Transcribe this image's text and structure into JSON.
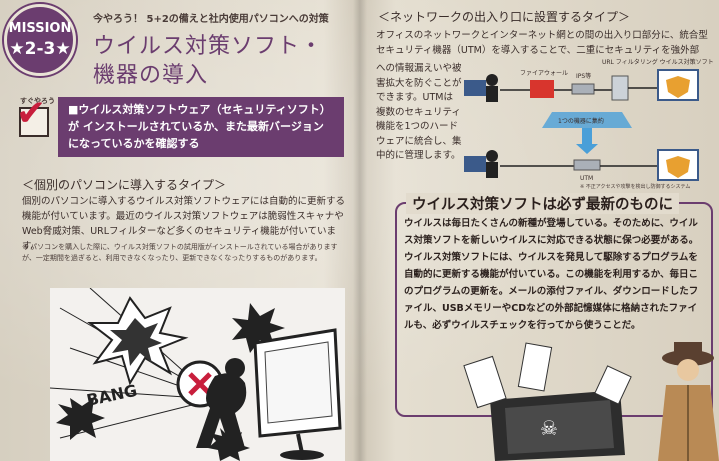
{
  "badge": {
    "line1": "MISSION",
    "line2": "★2-3★"
  },
  "header": {
    "subtitle": "今やろう！ 5+2の備えと社内使用パソコンへの対策",
    "title_line1": "ウイルス対策ソフト・",
    "title_line2": "機器の導入"
  },
  "checklist": {
    "label": "すぐやろう",
    "text": "■ウイルス対策ソフトウェア（セキュリティソフト）が インストールされているか、また最新バージョン になっているかを確認する"
  },
  "left_section": {
    "heading": "＜個別のパソコンに導入するタイプ＞",
    "body": "個別のパソコンに導入するウイルス対策ソフトウェアには自動的に更新する機能が付いています。最近のウイルス対策ソフトウェアは脆弱性スキャナや Web脅威対策、URLフィルターなど多くのセキュリティ機能が付いています。",
    "note": "※ パソコンを購入した際に、ウイルス対策ソフトの試用版がインストールされている場合がありますが、一定期間を過ぎると、利用できなくなったり、更新できなくなったりするものがあります。",
    "illustration_text": "BANG"
  },
  "right_section": {
    "heading": "＜ネットワークの出入り口に設置するタイプ＞",
    "body_top": "オフィスのネットワークとインターネット網との間の出入り口部分に、統合型セキュリティ機器（UTM）を導入することで、二重にセキュリティを強外部",
    "body_side": "への情報漏えいや被害拡大を防ぐことができます。UTMは複数のセキュリティ機能を1つのハードウェアに統合し、集中的に管理します。",
    "diagram": {
      "firewall": "ファイアウォール",
      "ips": "IPS等",
      "url_filter": "URL フィルタリング ウイルス対策ソフト",
      "merge": "1つの機器に集約",
      "utm": "UTM"
    },
    "caption": "※ 不正アクセスや攻撃を検出し防御するシステム"
  },
  "panel": {
    "title": "ウイルス対策ソフトは必ず最新のものに",
    "text": "ウイルスは毎日たくさんの新種が登場している。そのために、ウイルス対策ソフトを新しいウイルスに対応できる状態に保つ必要がある。ウイルス対策ソフトには、ウイルスを発見して駆除するプログラムを自動的に更新する機能が付いている。この機能を利用するか、毎日このプログラムの更新を。メールの添付ファイル、ダウンロードしたファイル、USBメモリーやCDなどの外部記憶媒体に格納されたファイルも、必ずウイルスチェックを行ってから使うことだ。"
  },
  "colors": {
    "accent": "#6b3d6f",
    "check": "#c81e3c",
    "text": "#3a2d2a"
  }
}
